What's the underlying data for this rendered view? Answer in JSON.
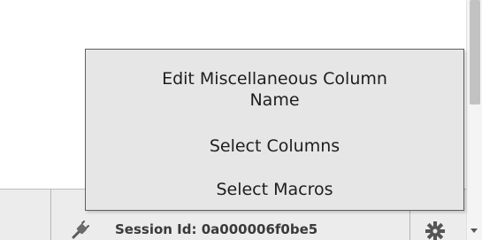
{
  "status_bar": {
    "session_text": "Session Id: 0a000006f0be5",
    "connection_icon": "plug-icon",
    "settings_icon": "gear-icon"
  },
  "context_menu": {
    "items": [
      {
        "label_line1": "Edit Miscellaneous Column",
        "label_line2": "Name"
      },
      {
        "label": "Select Columns"
      },
      {
        "label": "Select Macros"
      }
    ]
  },
  "scrollbar": {
    "icon": "chevron-down-icon"
  }
}
